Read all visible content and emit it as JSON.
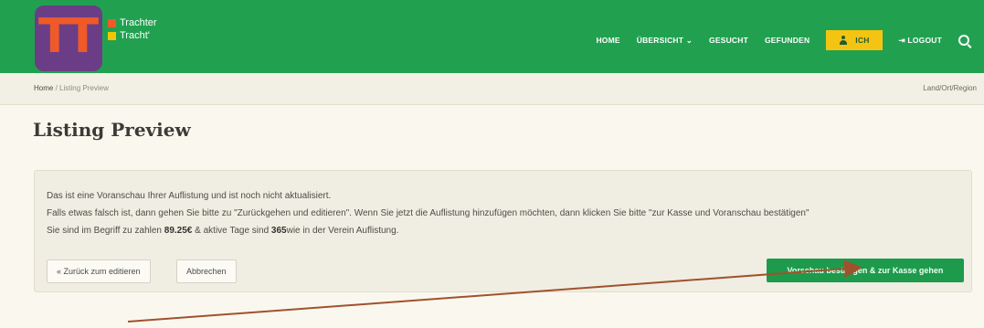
{
  "brand": {
    "logo_text": "TT",
    "line1": "Trachter",
    "line2": "Tracht'"
  },
  "nav": {
    "items": [
      {
        "label": "HOME"
      },
      {
        "label": "ÜBERSICHT ⌄"
      },
      {
        "label": "GESUCHT"
      },
      {
        "label": "GEFUNDEN"
      }
    ],
    "ich_label": "ICH",
    "logout_label": "⇥ LOGOUT"
  },
  "breadcrumb": {
    "home": "Home",
    "separator": "/",
    "current": "Listing Preview"
  },
  "region_label": "Land/Ort/Region",
  "page": {
    "title": "Listing Preview",
    "line1": "Das ist eine Voranschau Ihrer Auflistung und ist noch nicht aktualisiert.",
    "line2": "Falls etwas falsch ist, dann gehen Sie bitte zu \"Zurückgehen und editieren\". Wenn Sie jetzt die Auflistung hinzufügen möchten, dann klicken Sie bitte \"zur Kasse und Voranschau bestätigen\"",
    "line3_prefix": "Sie sind im Begriff zu zahlen ",
    "amount": "89.25€",
    "line3_mid": " & aktive Tage sind ",
    "days": "365",
    "line3_suffix": "wie in der Verein Auflistung."
  },
  "buttons": {
    "back": "« Zurück zum editieren",
    "cancel": "Abbrechen",
    "checkout": "Vorschau bestätigen & zur Kasse gehen"
  },
  "annotation": {
    "color": "#a0522d"
  }
}
